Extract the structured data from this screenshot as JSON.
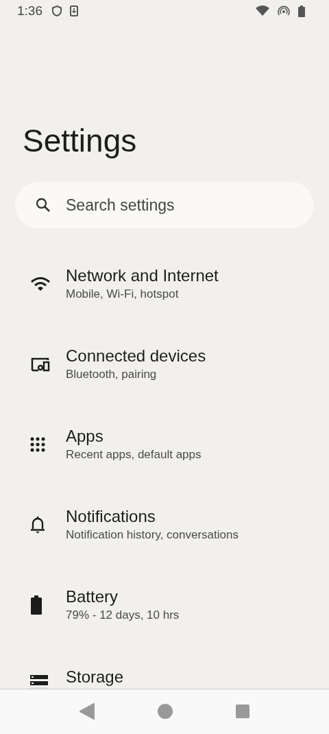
{
  "status_bar": {
    "time": "1:36"
  },
  "title": "Settings",
  "search": {
    "placeholder": "Search settings"
  },
  "items": [
    {
      "kind": "network",
      "title": "Network and Internet",
      "subtitle": "Mobile, Wi-Fi, hotspot"
    },
    {
      "kind": "devices",
      "title": "Connected devices",
      "subtitle": "Bluetooth, pairing"
    },
    {
      "kind": "apps",
      "title": "Apps",
      "subtitle": "Recent apps, default apps"
    },
    {
      "kind": "notifications",
      "title": "Notifications",
      "subtitle": "Notification history, conversations"
    },
    {
      "kind": "battery",
      "title": "Battery",
      "subtitle": "79% - 12 days, 10 hrs"
    },
    {
      "kind": "storage",
      "title": "Storage"
    }
  ]
}
